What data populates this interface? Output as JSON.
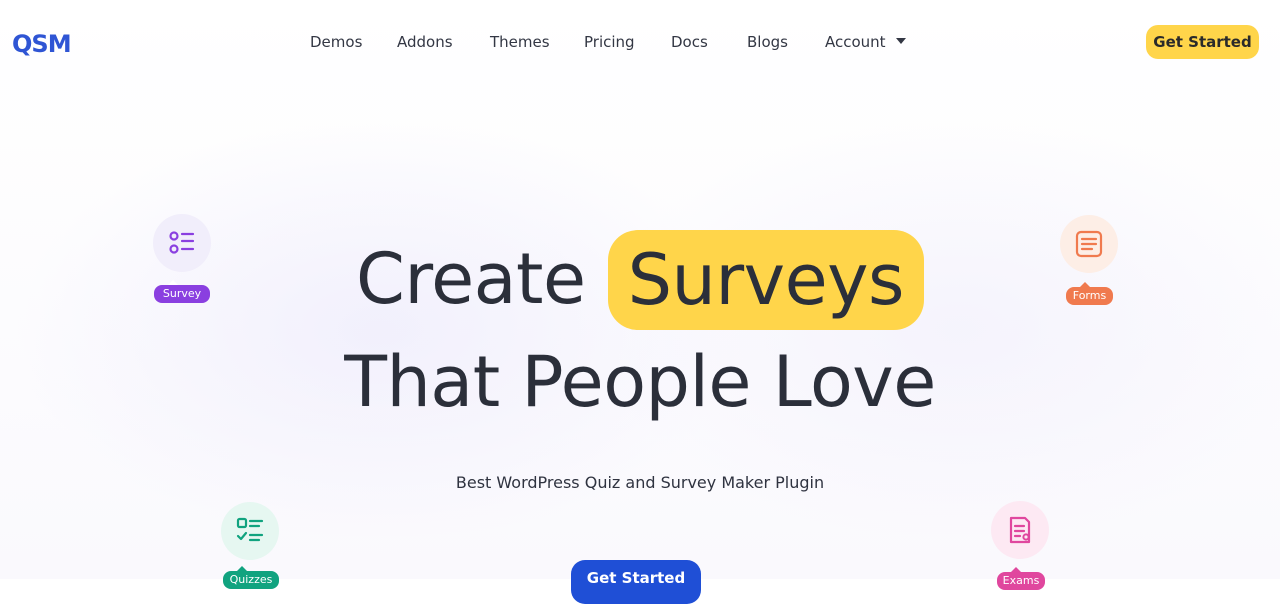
{
  "brand": {
    "logo_text": "QSM",
    "logo_color": "#2f55d4"
  },
  "nav": {
    "items": [
      {
        "label": "Demos"
      },
      {
        "label": "Addons"
      },
      {
        "label": "Themes"
      },
      {
        "label": "Pricing"
      },
      {
        "label": "Docs"
      },
      {
        "label": "Blogs"
      },
      {
        "label": "Account",
        "has_dropdown": true
      }
    ],
    "cta_label": "Get Started"
  },
  "hero": {
    "line1_prefix": "Create",
    "line1_highlight": "Surveys",
    "line2": "That People Love",
    "subtitle": "Best WordPress Quiz and Survey Maker Plugin",
    "cta_label": "Get Started",
    "highlight_color": "#ffd54a",
    "cta_color": "#1f4fd6"
  },
  "floaters": [
    {
      "label": "Survey",
      "icon": "list-options-icon",
      "color": "#8a3fe0",
      "bg": "#f1eefb"
    },
    {
      "label": "Forms",
      "icon": "form-icon",
      "color": "#f07a4e",
      "bg": "#fdeee6"
    },
    {
      "label": "Quizzes",
      "icon": "checklist-icon",
      "color": "#11a37f",
      "bg": "#e6f7f1"
    },
    {
      "label": "Exams",
      "icon": "document-icon",
      "color": "#e0479e",
      "bg": "#fde9f3"
    }
  ]
}
